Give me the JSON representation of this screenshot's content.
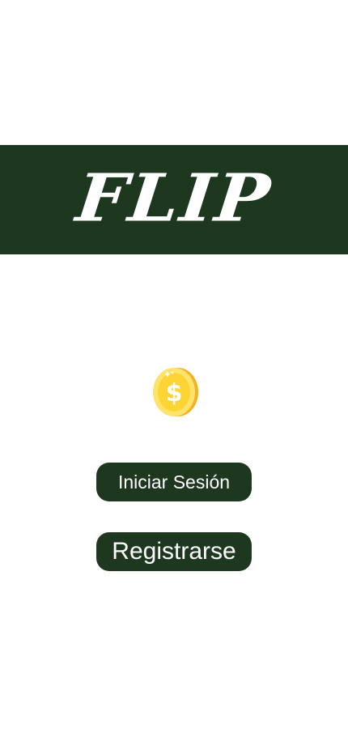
{
  "app": {
    "logo_text": "FLIP"
  },
  "icons": {
    "coin": "dollar-coin-icon"
  },
  "buttons": {
    "login_label": "Iniciar Sesión",
    "register_label": "Registrarse"
  },
  "colors": {
    "brand_green": "#1e3820",
    "background": "#ffffff",
    "coin_gold": "#fcd535"
  }
}
